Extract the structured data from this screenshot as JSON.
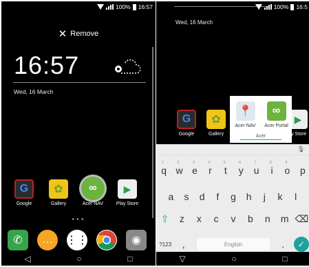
{
  "left": {
    "status": {
      "battery": "100%",
      "time": "16:57"
    },
    "remove_label": "Remove",
    "clock": "16:57",
    "date": "Wed, 16 March",
    "apps": [
      {
        "label": "Google",
        "glyph": "G"
      },
      {
        "label": "Gallery",
        "glyph": "✿"
      },
      {
        "label": "Acer NAV",
        "glyph": "∞"
      },
      {
        "label": "Play Store",
        "glyph": "▶"
      }
    ],
    "page_dots": "• • +",
    "dock": [
      {
        "name": "phone-icon",
        "glyph": "✆"
      },
      {
        "name": "hangouts-icon",
        "glyph": "…"
      },
      {
        "name": "app-drawer-icon",
        "glyph": "⋮⋮"
      },
      {
        "name": "chrome-icon",
        "glyph": ""
      },
      {
        "name": "camera-icon",
        "glyph": "◉"
      }
    ],
    "nav": {
      "back": "◁",
      "home": "○",
      "recents": "□"
    }
  },
  "right": {
    "status": {
      "battery": "100%",
      "time": "16:5"
    },
    "date": "Wed, 16 March",
    "apps": [
      {
        "label": "Google",
        "glyph": "G"
      },
      {
        "label": "Gallery",
        "glyph": "✿"
      },
      {
        "label": "Play Store",
        "glyph": "▶"
      }
    ],
    "folder": {
      "apps": [
        {
          "label": "Acer NAV",
          "glyph": "📍"
        },
        {
          "label": "Acer Portal",
          "glyph": "∞"
        }
      ],
      "name": "Acer"
    },
    "keyboard": {
      "row1": [
        "q",
        "w",
        "e",
        "r",
        "t",
        "y",
        "u",
        "i",
        "o",
        "p"
      ],
      "row1_nums": [
        "1",
        "2",
        "3",
        "4",
        "5",
        "6",
        "7",
        "8",
        "9",
        ""
      ],
      "row2": [
        "a",
        "s",
        "d",
        "f",
        "g",
        "h",
        "j",
        "k",
        "l"
      ],
      "row3": [
        "z",
        "x",
        "c",
        "v",
        "b",
        "n",
        "m"
      ],
      "symbols_label": "?123",
      "comma": ",",
      "space_label": "English",
      "period": ".",
      "shift": "⇧",
      "backspace": "⌫",
      "enter": "✓",
      "mic": "🎙"
    },
    "nav": {
      "back": "▽",
      "home": "○",
      "recents": "□"
    }
  }
}
